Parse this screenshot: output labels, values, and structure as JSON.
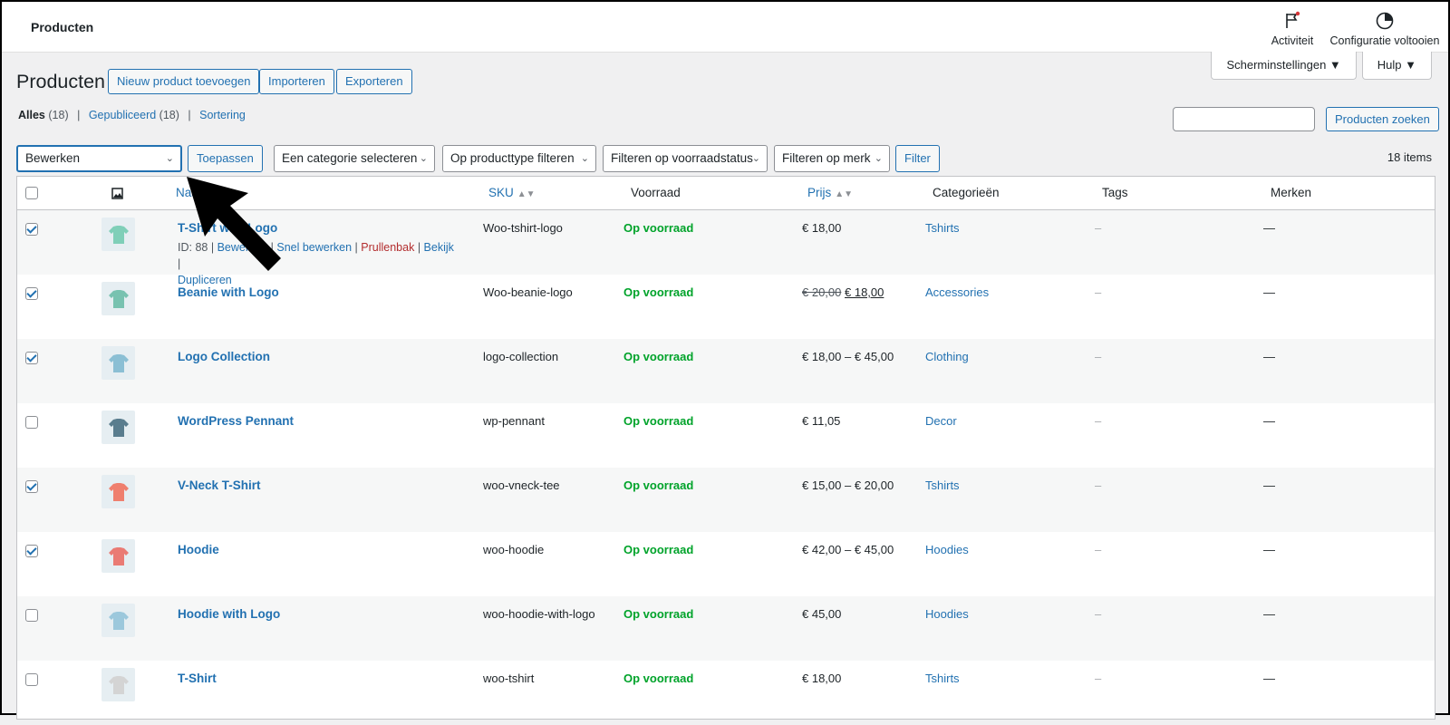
{
  "topbar": {
    "title": "Producten",
    "activity_label": "Activiteit",
    "setup_label": "Configuratie voltooien"
  },
  "screen_options": {
    "screen_label": "Scherminstellingen ▼",
    "help_label": "Hulp ▼"
  },
  "page": {
    "heading": "Producten",
    "add_new_label": "Nieuw product toevoegen",
    "import_label": "Importeren",
    "export_label": "Exporteren"
  },
  "views": {
    "all_label": "Alles",
    "all_count": "(18)",
    "published_label": "Gepubliceerd",
    "published_count": "(18)",
    "sorting_label": "Sortering"
  },
  "search": {
    "value": "",
    "button_label": "Producten zoeken"
  },
  "filters": {
    "bulk_action": "Bewerken",
    "apply_label": "Toepassen",
    "category": "Een categorie selecteren",
    "product_type": "Op producttype filteren",
    "stock_status": "Filteren op voorraadstatus",
    "brand": "Filteren op merk",
    "filter_label": "Filter",
    "item_count": "18 items"
  },
  "columns": {
    "name": "Naam",
    "sku": "SKU",
    "stock": "Voorraad",
    "price": "Prijs",
    "categories": "Categorieën",
    "tags": "Tags",
    "brands": "Merken"
  },
  "row_actions": {
    "id_text": "ID: 88",
    "edit": "Bewerken",
    "quick_edit": "Snel bewerken",
    "trash": "Prullenbak",
    "view": "Bekijk",
    "duplicate": "Dupliceren"
  },
  "products": [
    {
      "name": "T-Shirt with Logo",
      "sku": "Woo-tshirt-logo",
      "stock": "Op voorraad",
      "price": "€ 18,00",
      "old_price": "",
      "category": "Tshirts",
      "tags": "–",
      "brands": "—",
      "checked": true,
      "icon": "tshirt-green-icon",
      "color": "#7fcfb8"
    },
    {
      "name": "Beanie with Logo",
      "sku": "Woo-beanie-logo",
      "stock": "Op voorraad",
      "price": "€ 18,00",
      "old_price": "€ 20,00",
      "category": "Accessories",
      "tags": "–",
      "brands": "—",
      "checked": true,
      "icon": "beanie-icon",
      "color": "#78c2b0"
    },
    {
      "name": "Logo Collection",
      "sku": "logo-collection",
      "stock": "Op voorraad",
      "price": "€ 18,00 – € 45,00",
      "old_price": "",
      "category": "Clothing",
      "tags": "–",
      "brands": "—",
      "checked": true,
      "icon": "collection-icon",
      "color": "#8bbfd4"
    },
    {
      "name": "WordPress Pennant",
      "sku": "wp-pennant",
      "stock": "Op voorraad",
      "price": "€ 11,05",
      "old_price": "",
      "category": "Decor",
      "tags": "–",
      "brands": "—",
      "checked": false,
      "icon": "pennant-icon",
      "color": "#5a7d8e"
    },
    {
      "name": "V-Neck T-Shirt",
      "sku": "woo-vneck-tee",
      "stock": "Op voorraad",
      "price": "€ 15,00 – € 20,00",
      "old_price": "",
      "category": "Tshirts",
      "tags": "–",
      "brands": "—",
      "checked": true,
      "icon": "tshirt-red-icon",
      "color": "#ef7f6e"
    },
    {
      "name": "Hoodie",
      "sku": "woo-hoodie",
      "stock": "Op voorraad",
      "price": "€ 42,00 – € 45,00",
      "old_price": "",
      "category": "Hoodies",
      "tags": "–",
      "brands": "—",
      "checked": true,
      "icon": "hoodie-red-icon",
      "color": "#ea7b74"
    },
    {
      "name": "Hoodie with Logo",
      "sku": "woo-hoodie-with-logo",
      "stock": "Op voorraad",
      "price": "€ 45,00",
      "old_price": "",
      "category": "Hoodies",
      "tags": "–",
      "brands": "—",
      "checked": false,
      "icon": "hoodie-blue-icon",
      "color": "#9cc8dc"
    },
    {
      "name": "T-Shirt",
      "sku": "woo-tshirt",
      "stock": "Op voorraad",
      "price": "€ 18,00",
      "old_price": "",
      "category": "Tshirts",
      "tags": "–",
      "brands": "—",
      "checked": false,
      "icon": "tshirt-grey-icon",
      "color": "#d4d4d4"
    }
  ],
  "colors": {
    "accent": "#2271b1",
    "in_stock": "#00a32a",
    "trash": "#b32d2e"
  }
}
